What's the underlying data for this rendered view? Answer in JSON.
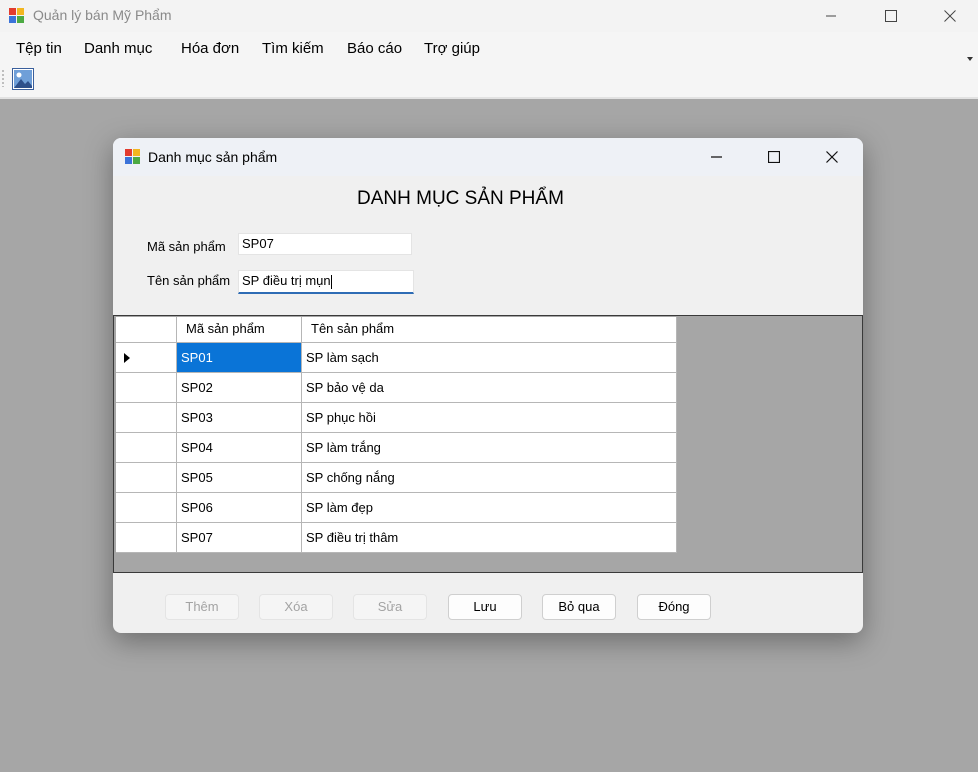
{
  "main_window": {
    "title": "Quản lý bán Mỹ Phẩm"
  },
  "menu": {
    "items": [
      "Tệp tin",
      "Danh mục",
      "Hóa đơn",
      "Tìm kiếm",
      "Báo cáo",
      "Trợ giúp"
    ]
  },
  "toolbar": {
    "items": [
      "image-icon"
    ]
  },
  "dialog": {
    "title": "Danh mục sản phẩm",
    "heading": "DANH MỤC SẢN PHẨM",
    "fields": {
      "ma_label": "Mã sản phẩm",
      "ma_value": "SP07",
      "ten_label": "Tên sản phẩm",
      "ten_value": "SP điều trị mụn"
    },
    "grid": {
      "columns": [
        "Mã sản phẩm",
        "Tên sản phẩm"
      ],
      "rows": [
        [
          "SP01",
          "SP làm sạch"
        ],
        [
          "SP02",
          "SP bảo vệ da"
        ],
        [
          "SP03",
          "SP phục hồi"
        ],
        [
          "SP04",
          "SP làm trắng"
        ],
        [
          "SP05",
          "SP chống nắng"
        ],
        [
          "SP06",
          "SP làm đẹp"
        ],
        [
          "SP07",
          "SP điều trị thâm"
        ]
      ],
      "selected_row": 0
    },
    "buttons": {
      "them": "Thêm",
      "xoa": "Xóa",
      "sua": "Sửa",
      "luu": "Lưu",
      "bo_qua": "Bỏ qua",
      "dong": "Đóng"
    }
  },
  "colors": {
    "workspace": "#a6a6a6",
    "selection": "#0a74d7",
    "focus_underline": "#2e6cb5",
    "disabled_text": "#a3a3a3"
  }
}
